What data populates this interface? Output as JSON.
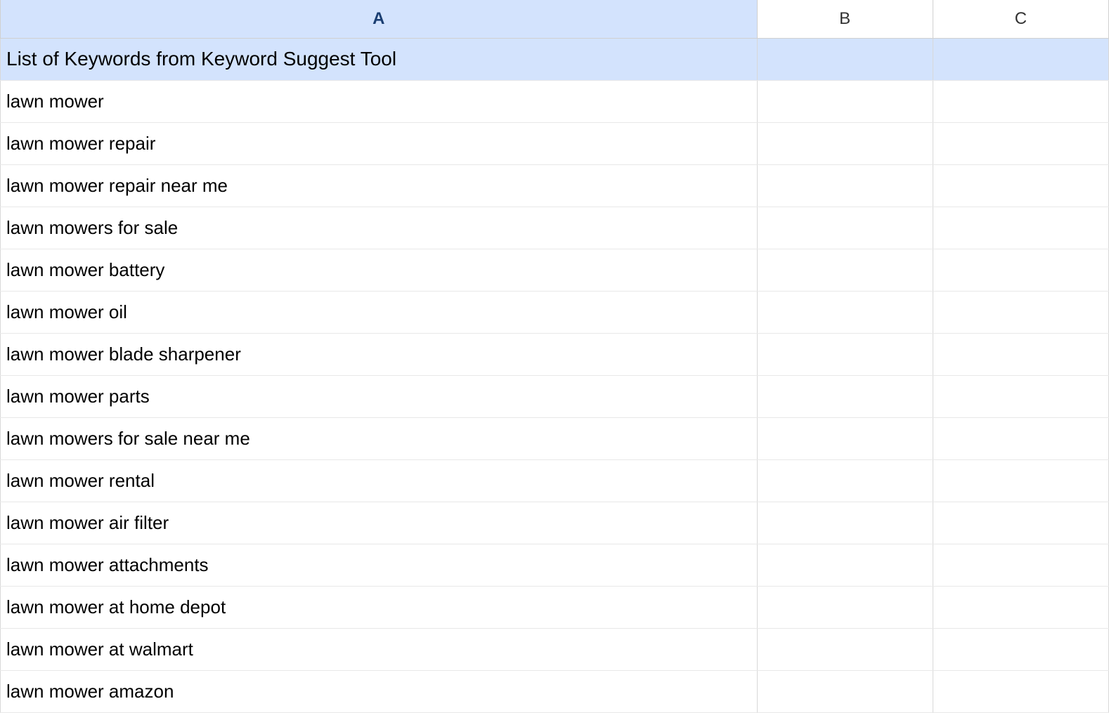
{
  "columns": {
    "a": "A",
    "b": "B",
    "c": "C"
  },
  "titleRow": "List of Keywords from Keyword Suggest Tool",
  "rows": [
    "lawn mower",
    "lawn mower repair",
    "lawn mower repair near me",
    "lawn mowers for sale",
    "lawn mower battery",
    "lawn mower oil",
    "lawn mower blade sharpener",
    "lawn mower parts",
    "lawn mowers for sale near me",
    "lawn mower rental",
    "lawn mower air filter",
    "lawn mower attachments",
    "lawn mower at home depot",
    "lawn mower at walmart",
    "lawn mower amazon"
  ]
}
